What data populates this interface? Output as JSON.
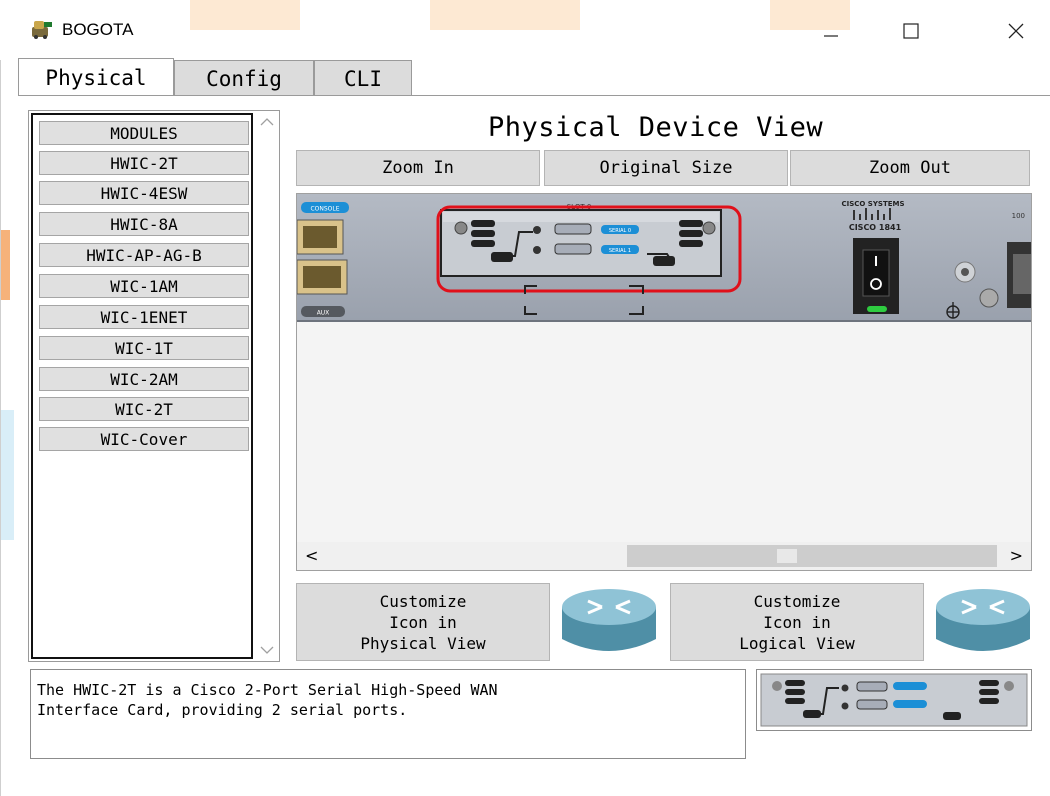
{
  "window": {
    "title": "BOGOTA"
  },
  "tabs": [
    {
      "label": "Physical",
      "active": true
    },
    {
      "label": "Config",
      "active": false
    },
    {
      "label": "CLI",
      "active": false
    }
  ],
  "modules": {
    "header": "MODULES",
    "items": [
      "HWIC-2T",
      "HWIC-4ESW",
      "HWIC-8A",
      "HWIC-AP-AG-B",
      "WIC-1AM",
      "WIC-1ENET",
      "WIC-1T",
      "WIC-2AM",
      "WIC-2T",
      "WIC-Cover"
    ]
  },
  "device_view": {
    "title": "Physical Device View",
    "zoom_in": "Zoom In",
    "original_size": "Original Size",
    "zoom_out": "Zoom Out"
  },
  "router": {
    "console_label": "CONSOLE",
    "aux_label": "AUX",
    "brand": "CISCO SYSTEMS",
    "model": "CISCO 1841",
    "slot_label": "SLOT 0",
    "serial_label_0": "SERIAL 0",
    "serial_label_1": "SERIAL 1",
    "right_label": "100"
  },
  "customize": {
    "physical": [
      "Customize",
      "Icon in",
      "Physical View"
    ],
    "logical": [
      "Customize",
      "Icon in",
      "Logical View"
    ]
  },
  "description": {
    "line1": "The HWIC-2T is a Cisco 2-Port Serial High-Speed WAN",
    "line2": "Interface Card, providing 2 serial ports."
  },
  "colors": {
    "highlight": "#e0101a",
    "router_body": "#a7adb8",
    "console_badge": "#1c8fd6",
    "power_led": "#2ecc40"
  }
}
